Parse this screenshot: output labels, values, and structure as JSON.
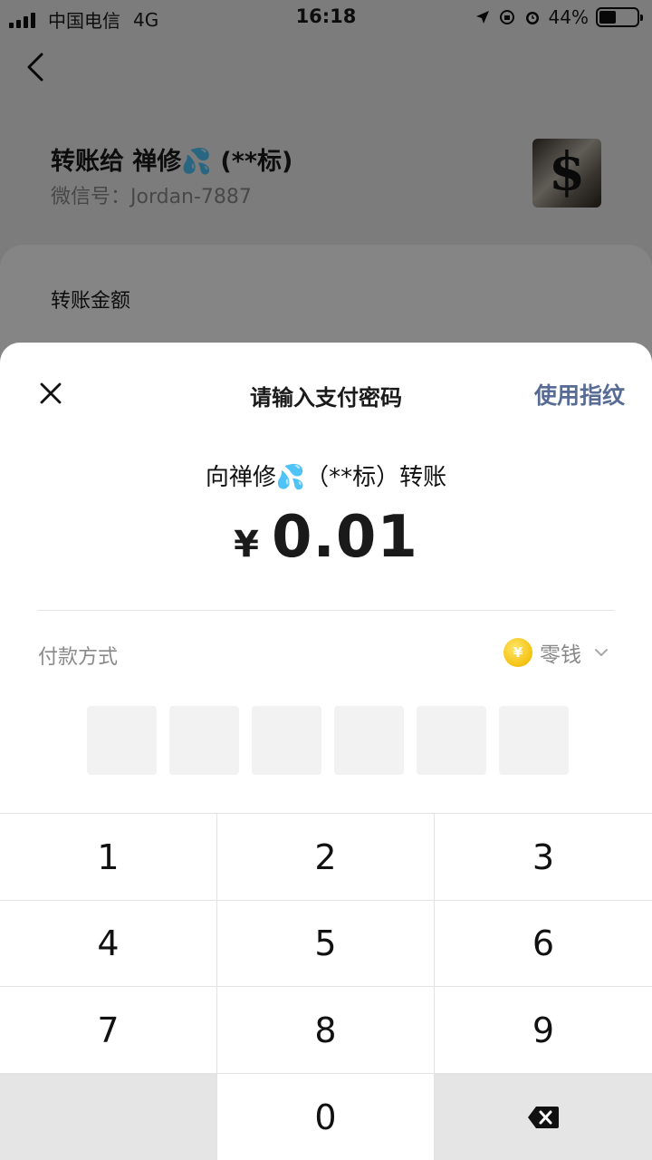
{
  "status_bar": {
    "carrier": "中国电信",
    "network": "4G",
    "time": "16:18",
    "battery": "44%",
    "battery_level": 0.44
  },
  "page": {
    "payee_title": "转账给 禅修💦 (**标)",
    "payee_id": "微信号：Jordan-7887",
    "avatar_icon": "ysl-logo-avatar",
    "amount_section_label": "转账金额"
  },
  "payment_sheet": {
    "title": "请输入支付密码",
    "fingerprint_label": "使用指纹",
    "recipient_line": "向禅修💦（**标）转账",
    "currency_symbol": "¥",
    "amount": "0.01",
    "pay_method_label": "付款方式",
    "pay_method_value": "零钱",
    "pay_method_icon": "coin-icon",
    "coin_glyph": "¥",
    "pin_length": 6
  },
  "keypad": {
    "keys": [
      "1",
      "2",
      "3",
      "4",
      "5",
      "6",
      "7",
      "8",
      "9",
      "",
      "0",
      "⌫"
    ],
    "delete_icon": "backspace-icon"
  },
  "colors": {
    "link": "#576b95",
    "coin": "#f5c518",
    "overlay": "rgba(0,0,0,0.48)"
  }
}
